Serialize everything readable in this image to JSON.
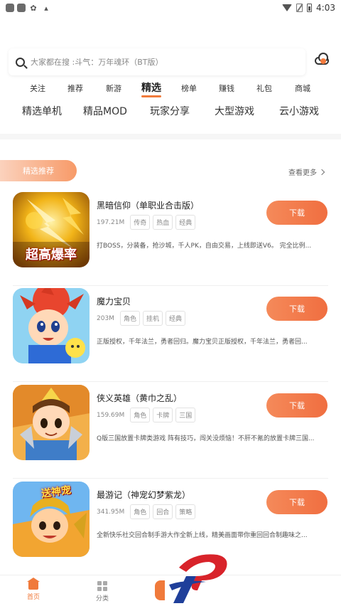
{
  "status_bar": {
    "time": "4:03",
    "left_icons": [
      "app-icon",
      "app-icon",
      "bug-icon",
      "font-icon"
    ],
    "right_icons": [
      "wifi-icon",
      "no-sim-icon",
      "battery-icon"
    ]
  },
  "search": {
    "placeholder": "大家都在搜 :斗气：万年魂环（BT版）"
  },
  "tabs": [
    {
      "label": "关注"
    },
    {
      "label": "推荐"
    },
    {
      "label": "新游"
    },
    {
      "label": "精选",
      "active": true
    },
    {
      "label": "榜单"
    },
    {
      "label": "赚钱"
    },
    {
      "label": "礼包"
    },
    {
      "label": "商城"
    }
  ],
  "categories": [
    "精选单机",
    "精品MOD",
    "玩家分享",
    "大型游戏",
    "云小游戏"
  ],
  "section": {
    "title": "精选推荐",
    "more": "查看更多"
  },
  "download_label": "下载",
  "games": [
    {
      "name": "黑暗信仰（单职业合击版）",
      "size": "197.21M",
      "tags": [
        "传奇",
        "热血",
        "经典"
      ],
      "desc": "打BOSS，分装备，抢沙城，千人PK，自由交易，上线即送V6。 完全比例...",
      "thumb_text": "超高爆率"
    },
    {
      "name": "魔力宝贝",
      "size": "203M",
      "tags": [
        "角色",
        "挂机",
        "经典"
      ],
      "desc": "正版授权，千年法兰，勇者回归。魔力宝贝正版授权，千年法兰，勇者回...",
      "thumb_text": ""
    },
    {
      "name": "侠义英雄（黄巾之乱）",
      "size": "159.69M",
      "tags": [
        "角色",
        "卡牌",
        "三国"
      ],
      "desc": "Q版三国放置卡牌类游戏 阵有技巧，闯关没烦恼！不肝不氪的放置卡牌三国...",
      "thumb_text": ""
    },
    {
      "name": "最游记（神宠幻梦紫龙）",
      "size": "341.95M",
      "tags": [
        "角色",
        "回合",
        "策略"
      ],
      "desc": "全新快乐社交回合制手游大作全新上线，精美画面带你重回回合制趣味之...",
      "thumb_text": "送神宠"
    }
  ],
  "bottom_nav": [
    {
      "label": "首页",
      "icon": "home-icon",
      "active": true
    },
    {
      "label": "分类",
      "icon": "grid-icon",
      "active": false
    }
  ],
  "colors": {
    "accent": "#f07a3b",
    "button": "#f37646"
  }
}
